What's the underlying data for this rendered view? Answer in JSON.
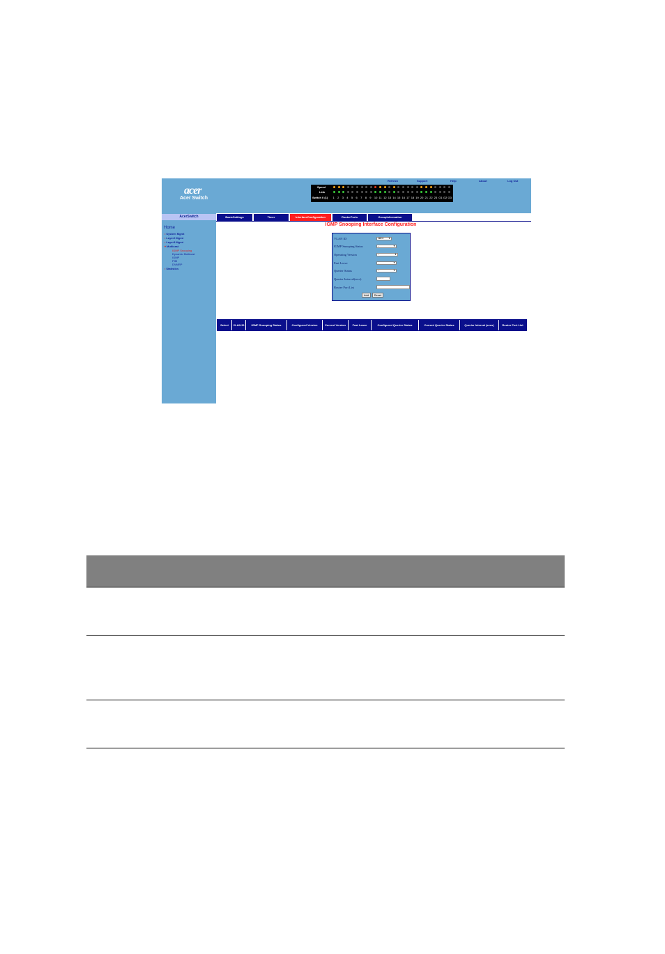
{
  "header": {
    "logo_text": "acer",
    "brand": "Acer Switch",
    "links": [
      "Refresh",
      "Support",
      "Help",
      "About",
      "Log Out"
    ]
  },
  "panel": {
    "speed_label": "Speed",
    "link_label": "Link",
    "port_label": "Switch 0 (1)",
    "ports": [
      "1",
      "2",
      "3",
      "4",
      "5",
      "6",
      "7",
      "8",
      "9",
      "10",
      "11",
      "12",
      "13",
      "14",
      "15",
      "16",
      "17",
      "18",
      "19",
      "20",
      "21",
      "22",
      "23",
      "G1",
      "G2",
      "G3"
    ]
  },
  "sidebar": {
    "header": "AcerSwitch",
    "home": "Home",
    "items": [
      "System Mgmt",
      "Layer2 Mgmt",
      "Layer3 Mgmt",
      "Multicast"
    ],
    "multicast_sub": [
      "IGMP Snooping",
      "Dynamic Multicast",
      "IGMP",
      "PIM",
      "DVMRP"
    ],
    "statistics": "Statistics"
  },
  "tabs": [
    "BasicSettings",
    "Timer",
    "InterfaceConfiguration",
    "RouterPorts",
    "GroupInformation"
  ],
  "active_tab": "InterfaceConfiguration",
  "page_title": "IGMP Snooping Interface Configuration",
  "form": {
    "vlan_label": "VLAN ID",
    "vlan_value": "vlan1",
    "status_label": "IGMP Snooping Status",
    "version_label": "Operating Version",
    "fast_leave_label": "Fast Leave",
    "querier_status_label": "Querier Status",
    "querier_interval_label": "Querier Interval(secs)",
    "router_port_label": "Router Port List",
    "select_value": "-",
    "add_button": "Add",
    "reset_button": "Reset"
  },
  "grid_columns": [
    "Select",
    "VLAN ID",
    "IGMP Snooping Status",
    "Configured Version",
    "Current Version",
    "Fast Leave",
    "Configured Querier Status",
    "Current Querier Status",
    "Querier Interval (secs)",
    "Router Port List"
  ],
  "colors": {
    "banner": "#6aa9d4",
    "tab": "#0a0f8c",
    "active_tab": "#ff1f1f",
    "title": "#ff1f1f",
    "table_header": "#808080"
  }
}
